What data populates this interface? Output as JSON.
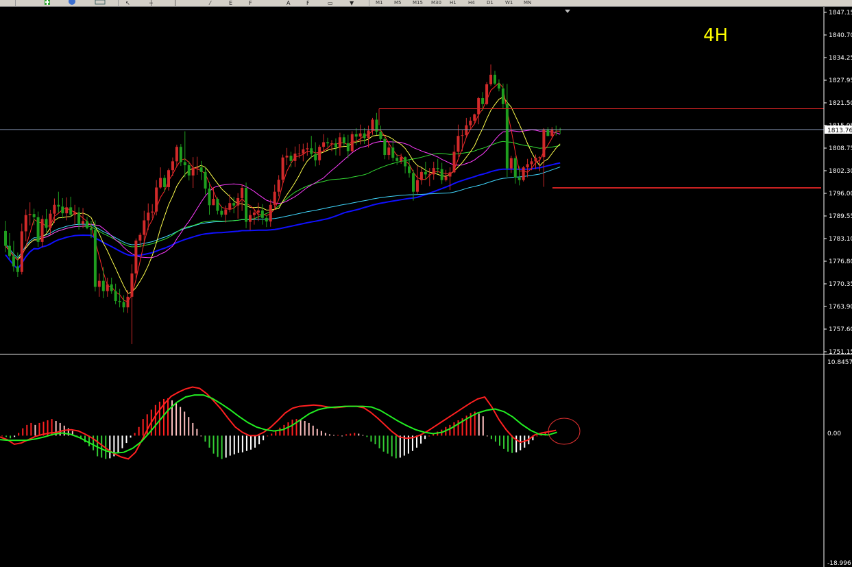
{
  "toolbar": {
    "timeframes": [
      "M1",
      "M5",
      "M15",
      "M30",
      "H1",
      "H4",
      "D1",
      "W1",
      "MN"
    ],
    "icons": [
      "crosshair-icon",
      "new-order-icon",
      "autotrading-icon",
      "history-icon",
      "cursor-icon",
      "line-icon",
      "trendline-icon",
      "fibo-icon",
      "text-icon",
      "label-icon",
      "shapes-icon",
      "arrow-icon"
    ]
  },
  "chart": {
    "timeframe_label": "4H",
    "price_axis_labels": [
      "1847.15",
      "1840.70",
      "1834.25",
      "1827.95",
      "1821.50",
      "1815.05",
      "1808.75",
      "1802.30",
      "1796.00",
      "1789.55",
      "1783.10",
      "1776.80",
      "1770.35",
      "1763.90",
      "1757.60",
      "1751.15"
    ],
    "current_price": "1813.76",
    "colors": {
      "bull": "#d12a2a",
      "bear": "#1f9e1f",
      "ma_yellow": "#ffff4d",
      "ma_red": "#ff2a2a",
      "ma_magenta": "#ff3cff",
      "ma_blue": "#1010ff",
      "ma_green": "#33dd33",
      "ma_cyan": "#40d8ff",
      "bid_line": "#8d9bbb",
      "hline": "#cc2222"
    }
  },
  "indicator": {
    "axis_labels": [
      "10.8457",
      "0.00",
      "-18.996"
    ],
    "colors": {
      "hist_up_strong": "#ff2020",
      "hist_up_weak": "#ffc0c0",
      "hist_dn_strong": "#33cc33",
      "hist_dn_weak": "#ffffff",
      "fast": "#ff2020",
      "slow": "#22ee22",
      "highlight": "#e03030"
    }
  },
  "chart_data": {
    "type": "candlestick",
    "timeframe": "4H",
    "ylim": [
      1751.15,
      1847.15
    ],
    "current_price": 1813.76,
    "horizontal_levels": [
      1819.9,
      1797.5
    ],
    "bars": [
      [
        1785.3,
        1788.2,
        1779.3,
        1781.1
      ],
      [
        1781.1,
        1784.7,
        1777.2,
        1778.2
      ],
      [
        1778.2,
        1782.5,
        1773.8,
        1775.3
      ],
      [
        1775.3,
        1779.2,
        1772.3,
        1773.7
      ],
      [
        1773.7,
        1787.4,
        1773.0,
        1785.2
      ],
      [
        1785.2,
        1791.4,
        1782.4,
        1789.8
      ],
      [
        1789.8,
        1793.4,
        1786.9,
        1790.1
      ],
      [
        1790.1,
        1791.6,
        1787.0,
        1789.2
      ],
      [
        1789.2,
        1790.8,
        1780.8,
        1782.2
      ],
      [
        1782.2,
        1789.7,
        1780.7,
        1788.7
      ],
      [
        1788.7,
        1791.5,
        1785.1,
        1786.2
      ],
      [
        1786.2,
        1791.3,
        1784.3,
        1790.2
      ],
      [
        1790.2,
        1794.5,
        1787.6,
        1792.7
      ],
      [
        1792.7,
        1796.4,
        1790.5,
        1792.2
      ],
      [
        1792.2,
        1794.6,
        1788.9,
        1790.3
      ],
      [
        1790.3,
        1794.8,
        1788.3,
        1792.0
      ],
      [
        1792.0,
        1795.0,
        1789.3,
        1789.9
      ],
      [
        1789.9,
        1792.7,
        1787.0,
        1790.6
      ],
      [
        1790.6,
        1792.0,
        1785.7,
        1787.3
      ],
      [
        1787.3,
        1791.8,
        1786.1,
        1788.1
      ],
      [
        1788.1,
        1789.3,
        1785.8,
        1786.1
      ],
      [
        1786.1,
        1788.2,
        1783.3,
        1785.6
      ],
      [
        1785.6,
        1788.3,
        1768.2,
        1769.5
      ],
      [
        1769.5,
        1773.3,
        1766.7,
        1771.2
      ],
      [
        1771.2,
        1775.1,
        1766.3,
        1768.3
      ],
      [
        1768.3,
        1772.1,
        1766.7,
        1770.2
      ],
      [
        1770.2,
        1772.1,
        1767.5,
        1768.3
      ],
      [
        1768.3,
        1770.4,
        1764.6,
        1765.5
      ],
      [
        1765.5,
        1768.9,
        1763.7,
        1765.2
      ],
      [
        1765.2,
        1767.1,
        1762.3,
        1763.7
      ],
      [
        1763.7,
        1768.6,
        1762.1,
        1766.7
      ],
      [
        1766.7,
        1775.9,
        1753.3,
        1773.3
      ],
      [
        1773.3,
        1783.2,
        1771.2,
        1782.6
      ],
      [
        1782.6,
        1784.8,
        1780.7,
        1784.2
      ],
      [
        1784.2,
        1791.0,
        1781.4,
        1788.3
      ],
      [
        1788.3,
        1793.1,
        1785.6,
        1790.5
      ],
      [
        1790.5,
        1792.9,
        1788.9,
        1790.8
      ],
      [
        1790.8,
        1799.7,
        1789.7,
        1797.6
      ],
      [
        1797.6,
        1803.3,
        1797.2,
        1800.3
      ],
      [
        1800.3,
        1801.2,
        1796.4,
        1797.7
      ],
      [
        1797.7,
        1803.0,
        1796.7,
        1802.5
      ],
      [
        1802.5,
        1806.1,
        1800.8,
        1805.0
      ],
      [
        1805.0,
        1809.7,
        1803.6,
        1809.1
      ],
      [
        1809.1,
        1809.9,
        1803.7,
        1804.8
      ],
      [
        1804.8,
        1813.5,
        1800.5,
        1803.9
      ],
      [
        1803.9,
        1805.0,
        1799.6,
        1801.0
      ],
      [
        1801.0,
        1806.2,
        1797.5,
        1803.2
      ],
      [
        1803.2,
        1806.3,
        1801.2,
        1803.3
      ],
      [
        1803.3,
        1805.1,
        1799.7,
        1802.0
      ],
      [
        1802.0,
        1803.3,
        1795.6,
        1797.3
      ],
      [
        1797.3,
        1799.2,
        1789.9,
        1792.6
      ],
      [
        1792.6,
        1797.7,
        1792.6,
        1794.4
      ],
      [
        1794.4,
        1794.8,
        1790.0,
        1791.0
      ],
      [
        1791.0,
        1792.4,
        1789.2,
        1789.9
      ],
      [
        1789.9,
        1792.5,
        1787.7,
        1791.4
      ],
      [
        1791.4,
        1795.7,
        1790.6,
        1793.2
      ],
      [
        1793.2,
        1794.9,
        1790.3,
        1792.5
      ],
      [
        1792.5,
        1796.0,
        1788.8,
        1794.6
      ],
      [
        1794.6,
        1798.5,
        1791.0,
        1797.5
      ],
      [
        1797.5,
        1799.0,
        1786.1,
        1787.9
      ],
      [
        1787.9,
        1791.2,
        1785.5,
        1789.8
      ],
      [
        1789.8,
        1791.2,
        1787.1,
        1790.5
      ],
      [
        1790.5,
        1793.3,
        1788.1,
        1791.1
      ],
      [
        1791.1,
        1792.9,
        1787.1,
        1789.0
      ],
      [
        1789.0,
        1789.8,
        1786.4,
        1788.0
      ],
      [
        1788.0,
        1794.2,
        1786.5,
        1792.7
      ],
      [
        1792.7,
        1798.4,
        1791.9,
        1796.4
      ],
      [
        1796.4,
        1801.1,
        1795.1,
        1799.8
      ],
      [
        1799.8,
        1806.9,
        1798.8,
        1806.1
      ],
      [
        1806.1,
        1808.8,
        1803.9,
        1806.6
      ],
      [
        1806.6,
        1807.7,
        1803.3,
        1805.1
      ],
      [
        1805.1,
        1809.2,
        1803.4,
        1807.2
      ],
      [
        1807.2,
        1809.9,
        1805.9,
        1807.2
      ],
      [
        1807.2,
        1810.0,
        1805.0,
        1808.4
      ],
      [
        1808.4,
        1810.3,
        1806.6,
        1808.7
      ],
      [
        1808.7,
        1812.2,
        1805.9,
        1807.1
      ],
      [
        1807.1,
        1810.4,
        1803.6,
        1805.3
      ],
      [
        1805.3,
        1809.7,
        1803.9,
        1809.1
      ],
      [
        1809.1,
        1812.7,
        1807.5,
        1810.4
      ],
      [
        1810.4,
        1811.7,
        1809.0,
        1810.1
      ],
      [
        1810.1,
        1811.0,
        1807.9,
        1810.1
      ],
      [
        1810.1,
        1811.5,
        1806.7,
        1808.9
      ],
      [
        1808.9,
        1813.1,
        1806.6,
        1811.8
      ],
      [
        1811.8,
        1812.7,
        1809.4,
        1810.1
      ],
      [
        1810.1,
        1812.5,
        1805.9,
        1807.9
      ],
      [
        1807.9,
        1813.5,
        1807.6,
        1812.7
      ],
      [
        1812.7,
        1814.4,
        1809.6,
        1812.0
      ],
      [
        1812.0,
        1815.4,
        1809.8,
        1812.9
      ],
      [
        1812.9,
        1814.4,
        1809.9,
        1811.6
      ],
      [
        1811.6,
        1815.1,
        1808.9,
        1813.7
      ],
      [
        1813.7,
        1817.3,
        1812.5,
        1816.8
      ],
      [
        1816.8,
        1818.7,
        1812.4,
        1813.4
      ],
      [
        1813.4,
        1815.1,
        1810.6,
        1811.3
      ],
      [
        1811.3,
        1811.8,
        1805.6,
        1806.8
      ],
      [
        1806.8,
        1810.6,
        1805.5,
        1808.9
      ],
      [
        1808.9,
        1811.1,
        1805.0,
        1806.0
      ],
      [
        1806.0,
        1807.0,
        1804.0,
        1805.1
      ],
      [
        1805.1,
        1807.2,
        1804.3,
        1806.2
      ],
      [
        1806.2,
        1806.4,
        1801.6,
        1803.6
      ],
      [
        1803.6,
        1805.5,
        1800.4,
        1801.7
      ],
      [
        1801.7,
        1802.6,
        1793.9,
        1796.4
      ],
      [
        1796.4,
        1803.8,
        1795.8,
        1799.7
      ],
      [
        1799.7,
        1803.1,
        1798.4,
        1802.0
      ],
      [
        1802.0,
        1804.9,
        1799.8,
        1801.3
      ],
      [
        1801.3,
        1803.1,
        1798.0,
        1801.3
      ],
      [
        1801.3,
        1804.9,
        1799.8,
        1803.1
      ],
      [
        1803.1,
        1805.7,
        1801.6,
        1802.8
      ],
      [
        1802.8,
        1804.6,
        1798.6,
        1799.7
      ],
      [
        1799.7,
        1802.6,
        1799.3,
        1800.7
      ],
      [
        1800.7,
        1803.3,
        1796.9,
        1801.9
      ],
      [
        1801.9,
        1809.7,
        1801.7,
        1807.7
      ],
      [
        1807.7,
        1815.4,
        1806.3,
        1812.2
      ],
      [
        1812.2,
        1813.8,
        1807.9,
        1812.4
      ],
      [
        1812.4,
        1817.3,
        1811.8,
        1815.2
      ],
      [
        1815.2,
        1817.5,
        1814.3,
        1816.5
      ],
      [
        1816.5,
        1818.5,
        1815.8,
        1818.3
      ],
      [
        1818.3,
        1823.2,
        1815.5,
        1822.9
      ],
      [
        1822.9,
        1824.6,
        1819.3,
        1821.2
      ],
      [
        1821.2,
        1827.4,
        1820.9,
        1826.8
      ],
      [
        1826.8,
        1832.4,
        1826.3,
        1829.5
      ],
      [
        1829.5,
        1830.6,
        1826.6,
        1827.0
      ],
      [
        1827.0,
        1828.2,
        1824.8,
        1825.6
      ],
      [
        1825.6,
        1827.0,
        1819.8,
        1821.2
      ],
      [
        1821.2,
        1826.9,
        1800.6,
        1803.0
      ],
      [
        1803.0,
        1806.6,
        1801.7,
        1805.9
      ],
      [
        1805.9,
        1806.4,
        1798.7,
        1800.4
      ],
      [
        1800.4,
        1803.6,
        1798.2,
        1799.7
      ],
      [
        1799.7,
        1803.7,
        1799.3,
        1803.3
      ],
      [
        1803.3,
        1805.7,
        1800.5,
        1804.2
      ],
      [
        1804.2,
        1806.0,
        1802.5,
        1805.0
      ],
      [
        1805.0,
        1806.9,
        1802.8,
        1806.0
      ],
      [
        1806.0,
        1806.4,
        1802.2,
        1806.2
      ],
      [
        1806.2,
        1814.4,
        1797.8,
        1814.0
      ],
      [
        1814.0,
        1814.7,
        1812.1,
        1812.2
      ],
      [
        1812.2,
        1814.7,
        1811.7,
        1814.1
      ],
      [
        1814.1,
        1815.1,
        1812.3,
        1814.0
      ],
      [
        1814.0,
        1814.5,
        1812.8,
        1813.8
      ]
    ],
    "indicator": {
      "type": "histogram-with-lines",
      "ylim": [
        -18.996,
        10.8457
      ],
      "histogram": [
        0.0,
        -0.2,
        -0.4,
        -0.2,
        0.4,
        1.1,
        1.6,
        1.9,
        1.6,
        1.9,
        2.1,
        2.3,
        2.5,
        2.2,
        1.9,
        1.5,
        1.1,
        0.7,
        0.0,
        -0.5,
        -1.0,
        -1.6,
        -2.2,
        -3.1,
        -3.3,
        -3.5,
        -3.4,
        -3.1,
        -2.6,
        -1.9,
        -1.1,
        -0.3,
        0.4,
        1.3,
        2.5,
        3.2,
        3.9,
        4.6,
        5.1,
        5.5,
        5.6,
        5.3,
        4.9,
        4.3,
        3.6,
        2.8,
        1.9,
        1.0,
        0.0,
        -0.9,
        -1.8,
        -2.7,
        -3.2,
        -3.5,
        -3.3,
        -3.0,
        -2.8,
        -2.6,
        -2.5,
        -2.3,
        -2.1,
        -1.8,
        -1.3,
        -0.7,
        0.0,
        0.3,
        0.8,
        1.2,
        1.6,
        2.0,
        2.4,
        2.5,
        2.4,
        2.2,
        1.9,
        1.5,
        1.0,
        0.7,
        0.4,
        0.2,
        0.1,
        0.1,
        0.0,
        0.2,
        0.3,
        0.4,
        0.3,
        0.1,
        -0.2,
        -0.9,
        -1.3,
        -1.9,
        -2.4,
        -2.7,
        -3.1,
        -3.4,
        -3.3,
        -3.0,
        -2.7,
        -2.3,
        -1.8,
        -1.2,
        -0.5,
        0.0,
        0.3,
        0.6,
        0.9,
        1.3,
        1.6,
        2.0,
        2.3,
        2.6,
        3.0,
        3.4,
        3.6,
        3.3,
        2.9,
        0.0,
        -0.5,
        -0.9,
        -1.5,
        -2.0,
        -2.4,
        -2.6,
        -2.5,
        -2.2,
        -1.8,
        -1.3,
        -0.7,
        0.0,
        0.3,
        0.6
      ],
      "fast_line": [
        -0.2,
        -0.6,
        -1.3,
        -1.1,
        -0.6,
        -0.1,
        0.2,
        0.4,
        0.5,
        0.8,
        0.9,
        0.7,
        0.2,
        -0.4,
        -1.2,
        -2.0,
        -2.7,
        -3.2,
        -3.5,
        -2.5,
        -0.5,
        1.6,
        3.3,
        4.7,
        5.9,
        6.5,
        7.0,
        7.3,
        7.1,
        6.3,
        5.2,
        4.0,
        2.6,
        1.3,
        0.5,
        0.0,
        0.0,
        0.5,
        1.3,
        2.3,
        3.4,
        4.1,
        4.4,
        4.5,
        4.6,
        4.5,
        4.3,
        4.2,
        4.3,
        4.4,
        4.4,
        4.2,
        3.5,
        2.6,
        1.6,
        0.6,
        -0.2,
        -0.4,
        -0.3,
        0.1,
        0.7,
        1.4,
        2.1,
        2.8,
        3.5,
        4.2,
        4.9,
        5.5,
        5.8,
        4.3,
        2.4,
        0.9,
        -0.3,
        -1.0,
        -0.7,
        0.1,
        0.4,
        0.6,
        0.8
      ],
      "slow_line": [
        -0.6,
        -0.7,
        -0.7,
        -0.7,
        -0.5,
        -0.2,
        0.2,
        0.4,
        0.2,
        -0.3,
        -1.0,
        -1.7,
        -2.3,
        -2.6,
        -2.5,
        -1.9,
        -0.9,
        0.6,
        2.2,
        3.8,
        5.0,
        5.8,
        6.1,
        6.1,
        5.6,
        4.8,
        3.9,
        2.9,
        2.0,
        1.3,
        0.9,
        0.7,
        0.9,
        1.5,
        2.4,
        3.3,
        3.9,
        4.2,
        4.3,
        4.4,
        4.4,
        4.4,
        4.3,
        3.8,
        3.0,
        2.2,
        1.5,
        0.9,
        0.5,
        0.3,
        0.5,
        1.1,
        1.9,
        2.7,
        3.4,
        3.8,
        4.0,
        3.6,
        2.8,
        1.7,
        0.8,
        0.2,
        0.1,
        0.5
      ]
    }
  }
}
